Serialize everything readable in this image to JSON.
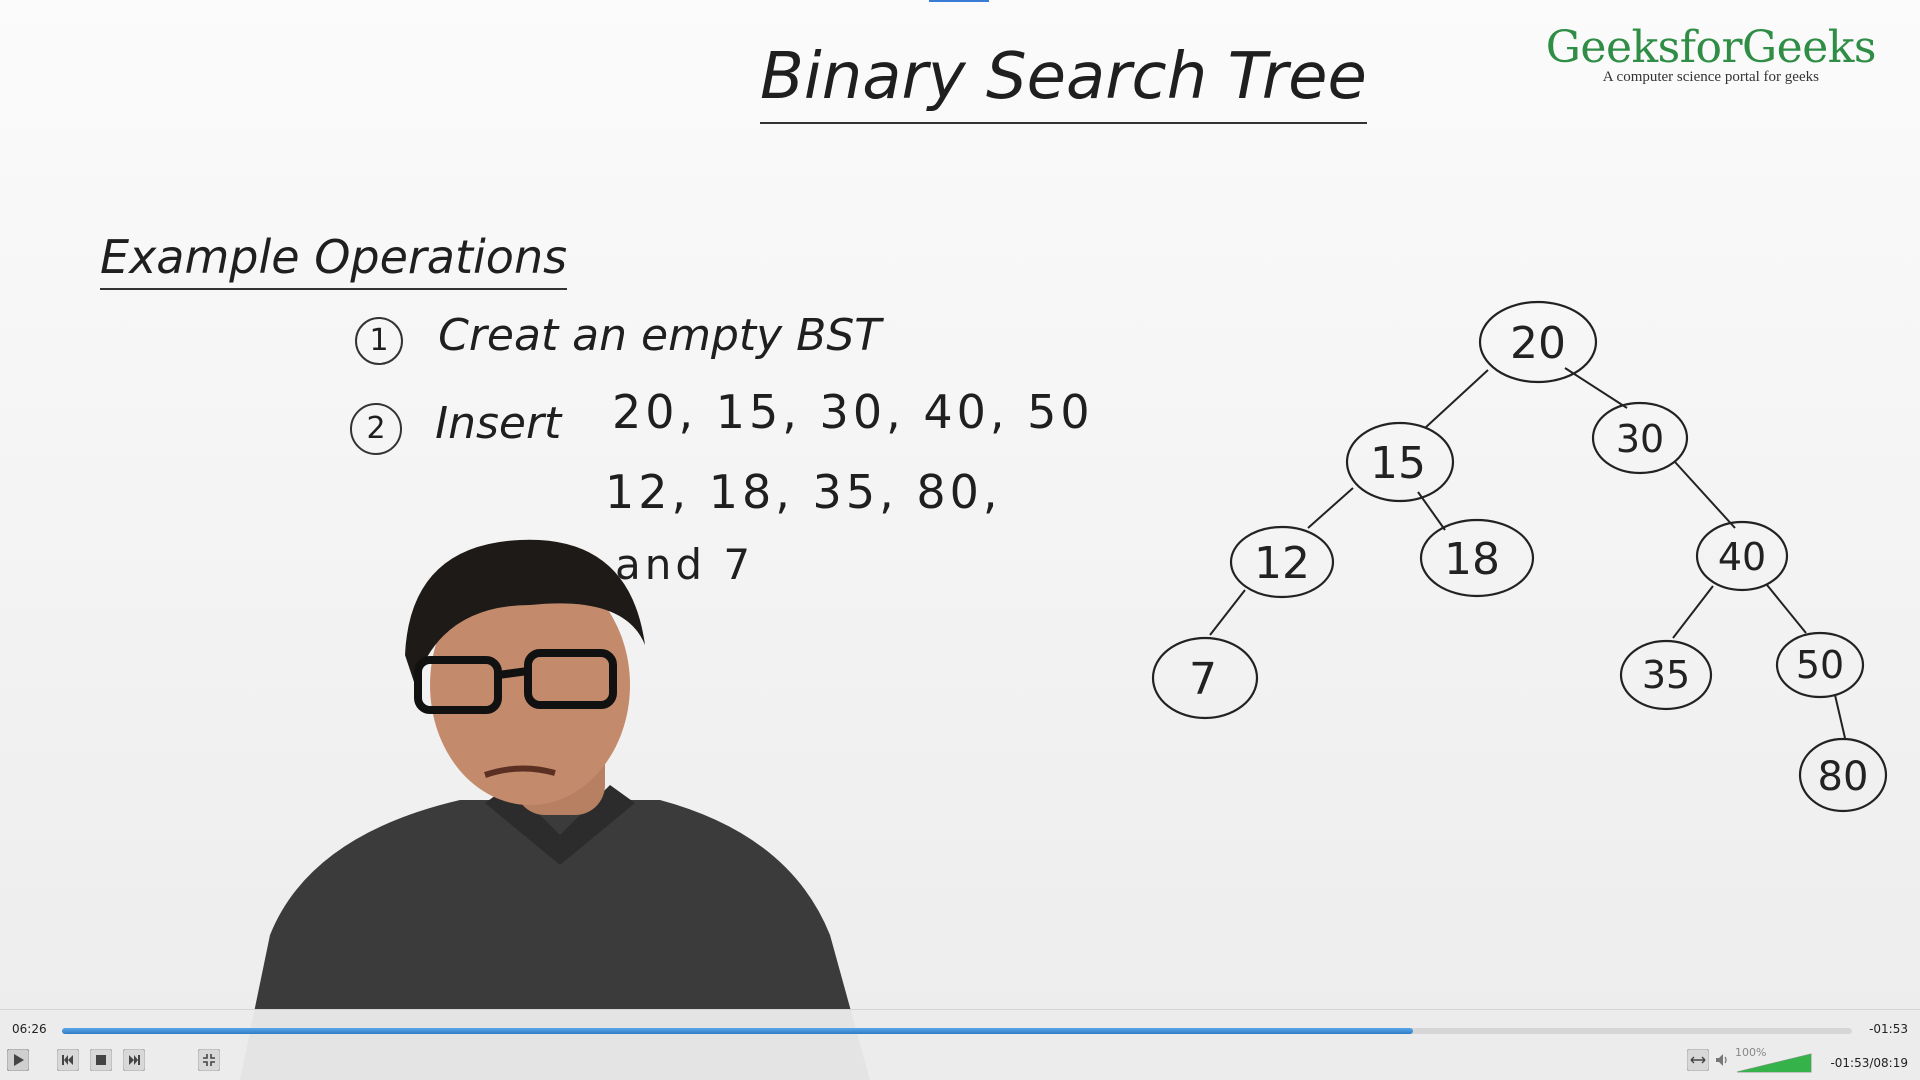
{
  "whiteboard": {
    "title": "Binary Search Tree",
    "section": "Example Operations",
    "steps": [
      {
        "num": "1",
        "text": "Creat an empty BST"
      },
      {
        "num": "2",
        "text": "Insert"
      }
    ],
    "insert_values": [
      "20, 15, 30, 40, 50",
      "12, 18, 35, 80,",
      "and 7"
    ],
    "tree_nodes": [
      "20",
      "15",
      "30",
      "12",
      "18",
      "40",
      "7",
      "35",
      "50",
      "80"
    ]
  },
  "brand": {
    "name": "GeeksforGeeks",
    "tagline": "A computer science portal for geeks"
  },
  "player": {
    "elapsed": "06:26",
    "remaining": "-01:53",
    "progress_fraction": 0.755,
    "volume_label": "100%",
    "volume_fraction": 1.0,
    "duration_readout": "-01:53/08:19",
    "icons": {
      "play": "play-icon",
      "prev": "skip-back-icon",
      "stop": "stop-icon",
      "next": "skip-forward-icon",
      "fullscreen": "exit-fullscreen-icon",
      "aspect": "aspect-ratio-icon",
      "volume": "speaker-icon"
    },
    "accent": "#2e7cc8"
  }
}
